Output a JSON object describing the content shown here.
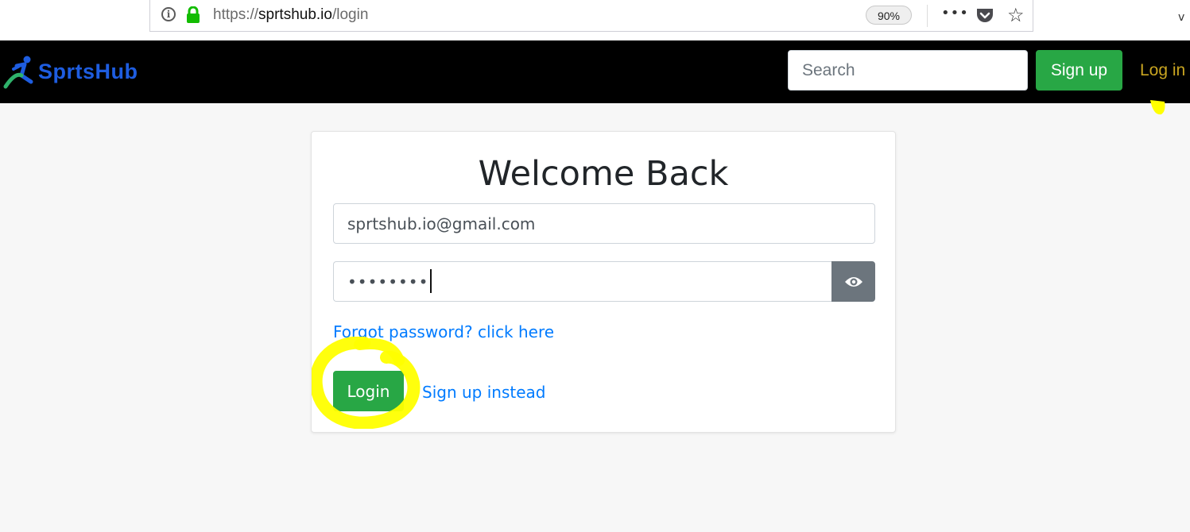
{
  "browser": {
    "url_prefix": "https://",
    "url_domain": "sprtshub.io",
    "url_path": "/login",
    "zoom": "90%",
    "more_glyph": "•••",
    "star_glyph": "☆",
    "edge_glyph": "v"
  },
  "navbar": {
    "logo_text": "SprtsHub",
    "search_placeholder": "Search",
    "signup_label": "Sign up",
    "login_label": "Log in",
    "logo_colors": {
      "primary": "#1e5de0",
      "accent": "#2fb26b"
    }
  },
  "login_card": {
    "title": "Welcome Back",
    "email_value": "sprtshub.io@gmail.com",
    "password_value": "••••••••",
    "forgot_text": "Forgot password? click here",
    "login_label": "Login",
    "signup_instead_text": "Sign up instead"
  },
  "colors": {
    "success": "#28a745",
    "link": "#007bff",
    "highlight": "#ffff00",
    "nav_bg": "#000000"
  }
}
